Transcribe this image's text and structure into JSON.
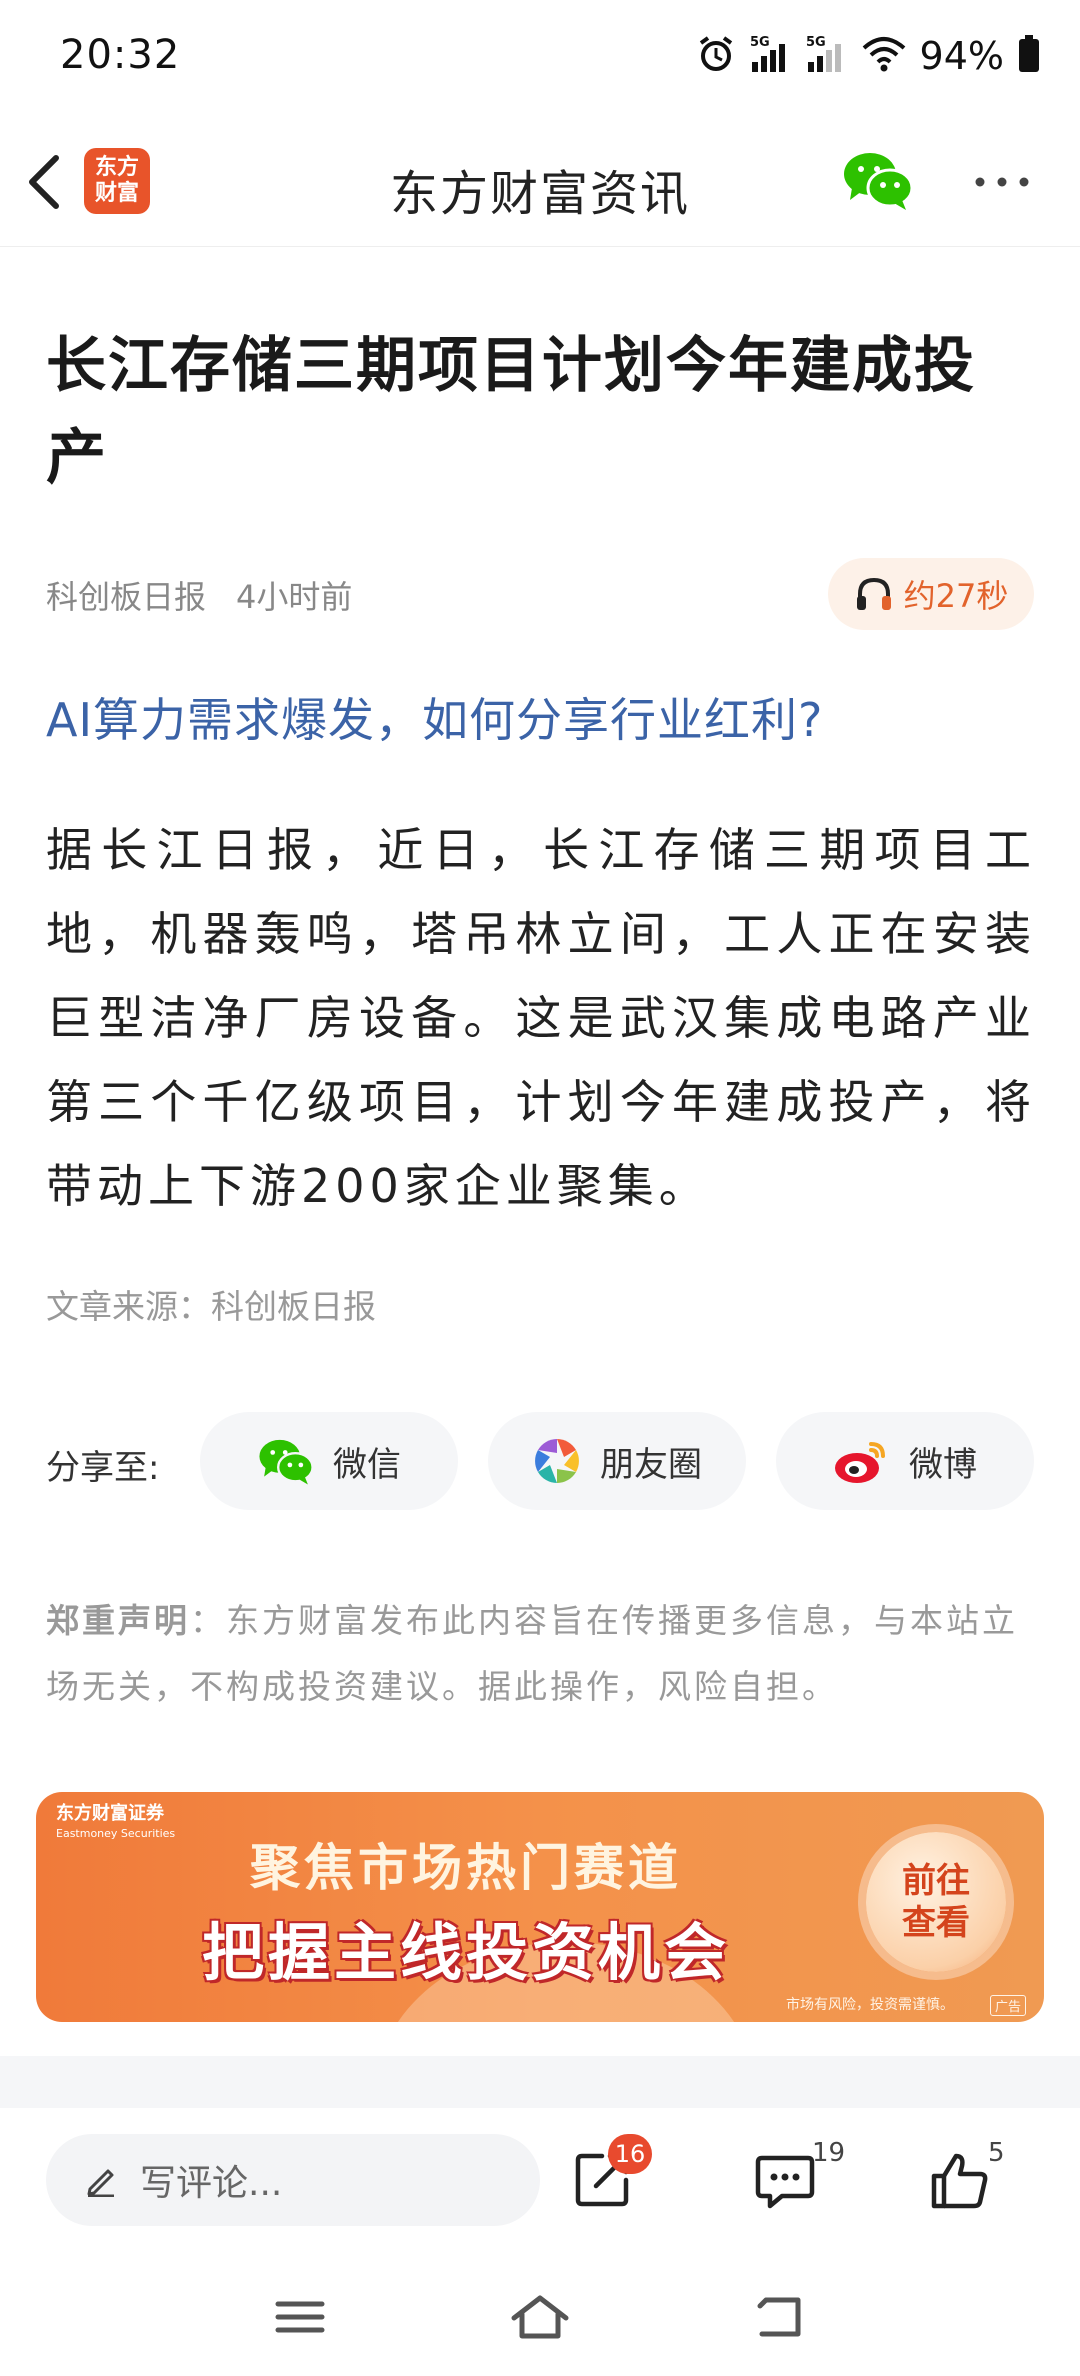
{
  "status_bar": {
    "time": "20:32",
    "battery": "94%",
    "network_1": "5G",
    "network_2": "5G",
    "icons": [
      "alarm-icon",
      "signal-icon",
      "signal-icon",
      "wifi-icon",
      "battery-icon"
    ]
  },
  "nav": {
    "title": "东方财富资讯",
    "logo_text_1": "东方",
    "logo_text_2": "财富",
    "icons": [
      "back-icon",
      "wechat-icon",
      "more-icon"
    ]
  },
  "article": {
    "title": "长江存储三期项目计划今年建成投产",
    "source_name": "科创板日报",
    "time_ago": "4小时前",
    "audio_duration": "约27秒",
    "promo_link": "AI算力需求爆发，如何分享行业红利?",
    "body": "据长江日报，近日，长江存储三期项目工地，机器轰鸣，塔吊林立间，工人正在安装巨型洁净厂房设备。这是武汉集成电路产业第三个千亿级项目，计划今年建成投产，将带动上下游200家企业聚集。",
    "source_line": "文章来源：科创板日报"
  },
  "share": {
    "label": "分享至:",
    "wechat": "微信",
    "moments": "朋友圈",
    "weibo": "微博"
  },
  "disclaimer": {
    "heading": "郑重声明",
    "text": "：东方财富发布此内容旨在传播更多信息，与本站立场无关，不构成投资建议。据此操作，风险自担。"
  },
  "ad": {
    "brand": "东方财富证券",
    "brand_en": "Eastmoney Securities",
    "line1": "聚焦市场热门赛道",
    "line2": "把握主线投资机会",
    "cta_1": "前往",
    "cta_2": "查看",
    "risk": "市场有风险，投资需谨慎。",
    "tag": "广告"
  },
  "bottom_bar": {
    "comment_placeholder": "写评论...",
    "share_count": "16",
    "comment_count": "19",
    "like_count": "5"
  },
  "colors": {
    "accent_orange": "#e2632c",
    "link_blue": "#3b63a7",
    "badge_red": "#e84a2e",
    "wechat_green": "#2dc100"
  }
}
